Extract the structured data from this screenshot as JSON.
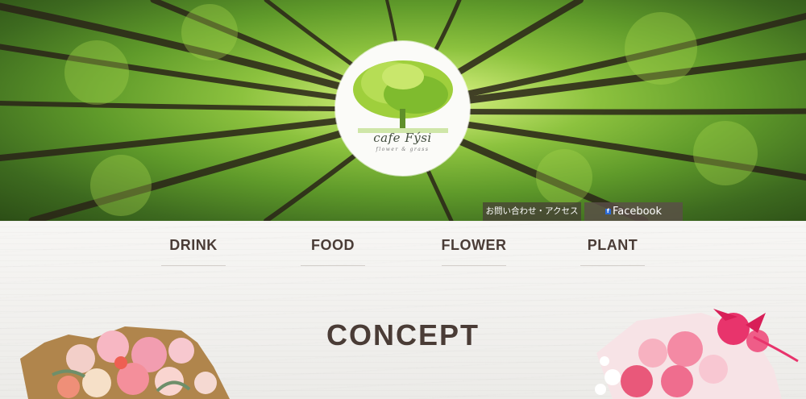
{
  "logo": {
    "name": "cafe Fýsi",
    "tagline": "flower & grass"
  },
  "header": {
    "contact_label": "お問い合わせ・アクセス",
    "facebook_label": "Facebook",
    "facebook_icon": "facebook-icon"
  },
  "nav": {
    "items": [
      {
        "label": "DRINK"
      },
      {
        "label": "FOOD"
      },
      {
        "label": "FLOWER"
      },
      {
        "label": "PLANT"
      }
    ]
  },
  "main": {
    "section_title": "CONCEPT"
  },
  "colors": {
    "text": "#4a3c36",
    "header_button": "#5a4e48",
    "leaf_green": "#8cc23e"
  }
}
